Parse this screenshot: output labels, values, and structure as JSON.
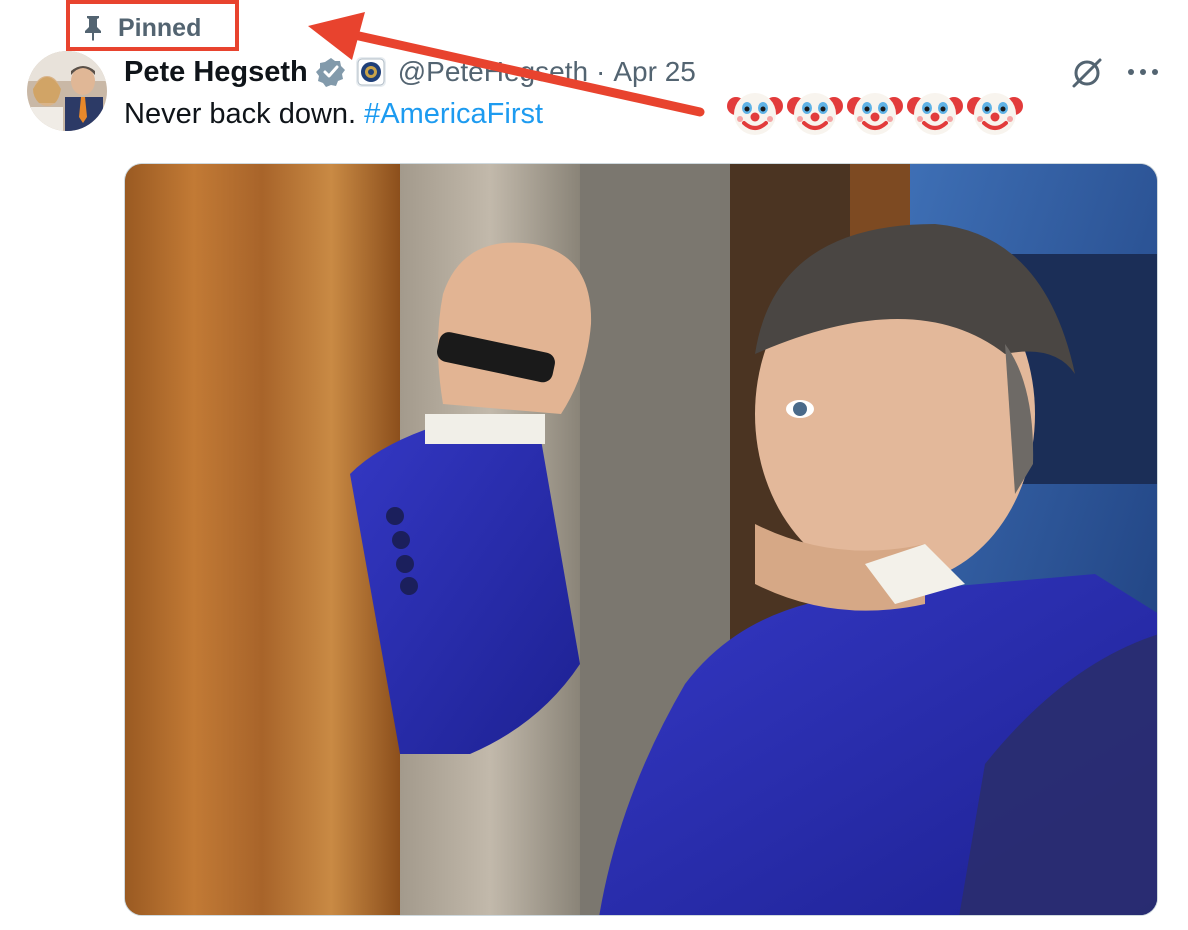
{
  "pinned": {
    "label": "Pinned"
  },
  "author": {
    "display_name": "Pete Hegseth",
    "handle": "@PeteHegseth",
    "separator": "·",
    "date": "Apr 25"
  },
  "tweet": {
    "text": "Never back down. ",
    "hashtag": "#AmericaFirst"
  },
  "annotations": {
    "clown_emoji": "🤡",
    "clown_count": 5,
    "highlight_color": "#e8432e"
  },
  "icons": {
    "pin": "pin-icon",
    "verified": "verified-badge-icon",
    "affiliation": "department-seal-icon",
    "grok": "grok-icon",
    "more": "more-icon"
  },
  "colors": {
    "secondary_text": "#536471",
    "link": "#1d9bf0",
    "highlight": "#e8432e",
    "suit_blue": "#2a2fa8"
  }
}
